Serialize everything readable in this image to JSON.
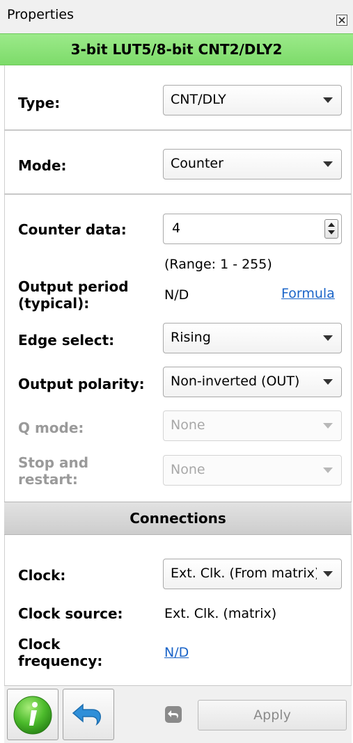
{
  "window": {
    "title": "Properties"
  },
  "header": {
    "title": "3-bit LUT5/8-bit CNT2/DLY2"
  },
  "fields": {
    "type": {
      "label": "Type:",
      "value": "CNT/DLY"
    },
    "mode": {
      "label": "Mode:",
      "value": "Counter"
    },
    "counter_data": {
      "label": "Counter data:",
      "value": "4",
      "range": "(Range:  1 - 255)"
    },
    "output_period": {
      "label_line1": "Output period",
      "label_line2": "(typical):",
      "value": "N/D",
      "link": "Formula"
    },
    "edge_select": {
      "label": "Edge select:",
      "value": "Rising"
    },
    "output_polarity": {
      "label": "Output polarity:",
      "value": "Non-inverted (OUT)"
    },
    "q_mode": {
      "label": "Q mode:",
      "value": "None"
    },
    "stop_restart": {
      "label_line1": "Stop and",
      "label_line2": "restart:",
      "value": "None"
    }
  },
  "connections": {
    "title": "Connections",
    "clock": {
      "label": "Clock:",
      "value": "Ext. Clk. (From matrix)"
    },
    "clock_source": {
      "label": "Clock source:",
      "value": "Ext. Clk. (matrix)"
    },
    "clock_frequency": {
      "label_line1": "Clock",
      "label_line2": "frequency:",
      "value": "N/D"
    }
  },
  "footer": {
    "apply_label": "Apply"
  },
  "colors": {
    "header_green": "#8ee27a",
    "link_blue": "#1a64c8",
    "info_green": "#3fae2a",
    "undo_blue": "#2f8fd8"
  },
  "icons": [
    "close-icon",
    "info-icon",
    "undo-icon",
    "small-undo-icon",
    "chevron-down-icon",
    "spin-up-icon",
    "spin-down-icon"
  ]
}
